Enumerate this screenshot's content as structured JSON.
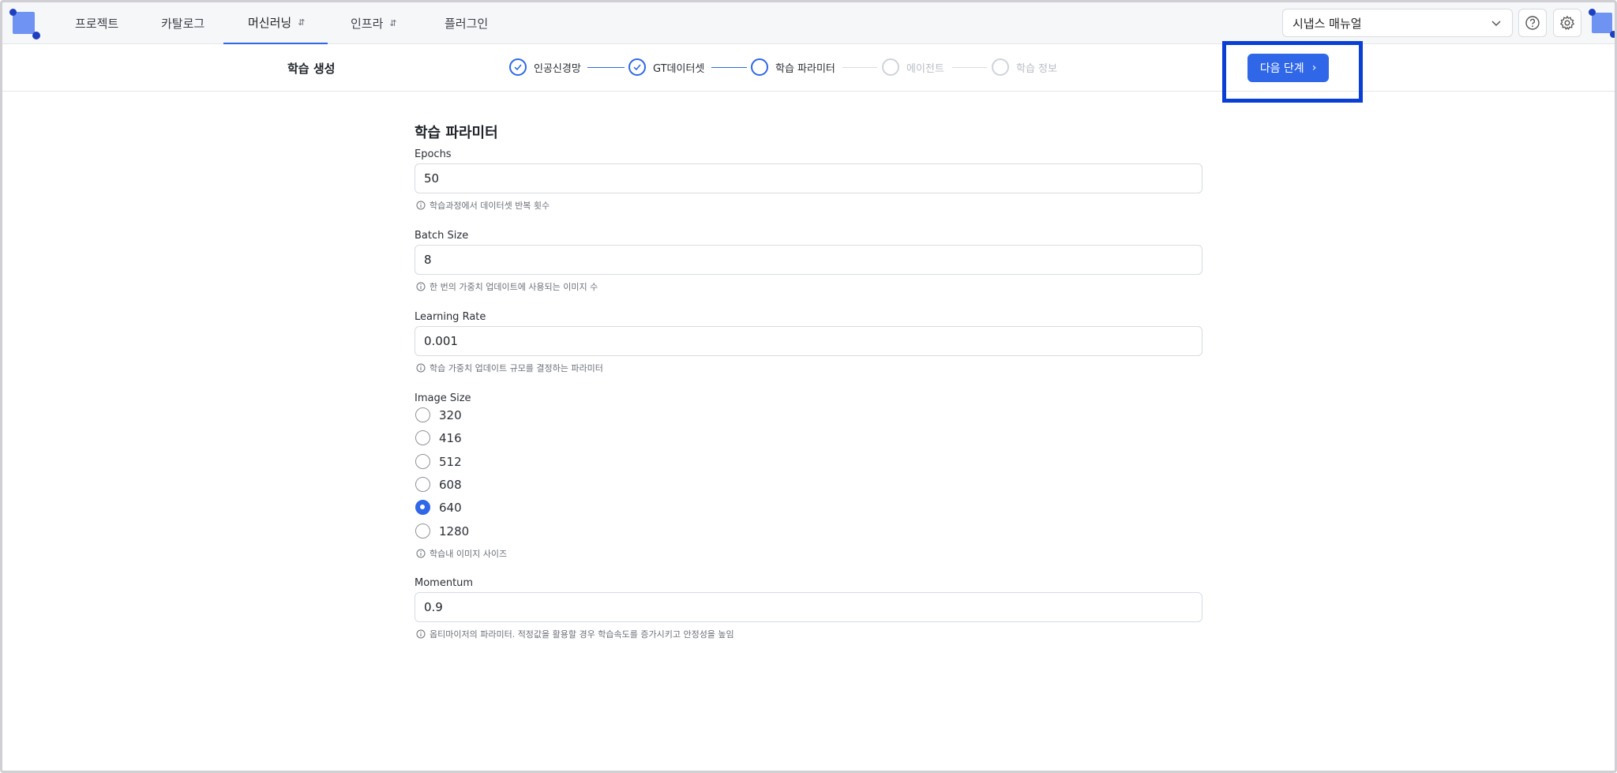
{
  "nav": {
    "items": [
      {
        "label": "프로젝트",
        "has_chevron": false,
        "active": false
      },
      {
        "label": "카탈로그",
        "has_chevron": false,
        "active": false
      },
      {
        "label": "머신러닝",
        "has_chevron": true,
        "active": true
      },
      {
        "label": "인프라",
        "has_chevron": true,
        "active": false
      },
      {
        "label": "플러그인",
        "has_chevron": false,
        "active": false
      }
    ],
    "manual_select": "시냅스 매뉴얼",
    "help_icon": "help-circle-icon",
    "settings_icon": "gear-icon"
  },
  "stepbar": {
    "heading": "학습 생성",
    "steps": [
      {
        "label": "인공신경망",
        "state": "done"
      },
      {
        "label": "GT데이터셋",
        "state": "done"
      },
      {
        "label": "학습 파라미터",
        "state": "current"
      },
      {
        "label": "에이전트",
        "state": "todo"
      },
      {
        "label": "학습 정보",
        "state": "todo"
      }
    ],
    "next_button": "다음 단계"
  },
  "form": {
    "title": "학습 파라미터",
    "epochs": {
      "label": "Epochs",
      "value": "50",
      "help": "학습과정에서 데이터셋 반복 횟수"
    },
    "batch_size": {
      "label": "Batch Size",
      "value": "8",
      "help": "한 번의 가중치 업데이트에 사용되는 이미지 수"
    },
    "learning_rate": {
      "label": "Learning Rate",
      "value": "0.001",
      "help": "학습 가중치 업데이트 규모를 결정하는 파라미터"
    },
    "image_size": {
      "label": "Image Size",
      "options": [
        "320",
        "416",
        "512",
        "608",
        "640",
        "1280"
      ],
      "selected": "640",
      "help": "학습내 이미지 사이즈"
    },
    "momentum": {
      "label": "Momentum",
      "value": "0.9",
      "help": "옵티마이저의 파라미터. 적정값을 활용할 경우 학습속도를 증가시키고 안정성을 높임"
    }
  },
  "colors": {
    "accent": "#2f67e8",
    "highlight": "#0a3fd6"
  }
}
